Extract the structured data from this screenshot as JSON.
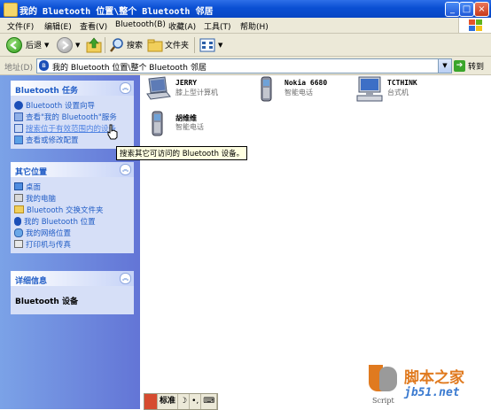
{
  "window": {
    "title": "我的 Bluetooth 位置\\整个 Bluetooth 邻居"
  },
  "menu": [
    "文件(F)",
    "编辑(E)",
    "查看(V)",
    "Bluetooth(B)",
    "收藏(A)",
    "工具(T)",
    "帮助(H)"
  ],
  "toolbar": {
    "back_label": "后退",
    "search_label": "搜索",
    "folders_label": "文件夹"
  },
  "address": {
    "label": "地址(D)",
    "value": "我的 Bluetooth 位置\\整个 Bluetooth 邻居",
    "go_label": "转到"
  },
  "panels": {
    "bluetooth_tasks": {
      "title": "Bluetooth 任务",
      "items": [
        "Bluetooth 设置向导",
        "查看\"我的 Bluetooth\"服务",
        "搜索位于有效范围内的设备",
        "查看或修改配置"
      ]
    },
    "other_places": {
      "title": "其它位置",
      "items": [
        "桌面",
        "我的电脑",
        "Bluetooth 交换文件夹",
        "我的 Bluetooth 位置",
        "我的网络位置",
        "打印机与传真"
      ]
    },
    "details": {
      "title": "详细信息",
      "text": "Bluetooth 设备"
    }
  },
  "devices": [
    {
      "name": "JERRY",
      "type": "膝上型计算机",
      "icon": "laptop-icon"
    },
    {
      "name": "Nokia 6680",
      "type": "智能电话",
      "icon": "phone-icon"
    },
    {
      "name": "TCTHINK",
      "type": "台式机",
      "icon": "desktop-icon"
    },
    {
      "name": "胡维维",
      "type": "智能电话",
      "icon": "phone-icon"
    }
  ],
  "tooltip": "搜索其它可访问的 Bluetooth 设备。",
  "ime": {
    "mode": "标准"
  },
  "watermark": {
    "cn": "脚本之家",
    "url": "jb51.net",
    "script": "Script"
  },
  "colors": {
    "title_bar": "#0a4fd3",
    "task_pane": "#7ba2e7",
    "link": "#215dc6"
  }
}
